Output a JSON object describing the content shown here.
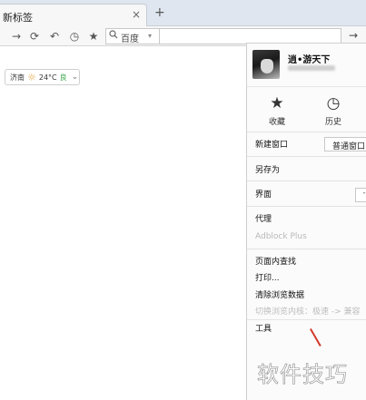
{
  "tab": {
    "title": "新标签",
    "close_glyph": "×",
    "new_tab_glyph": "+"
  },
  "toolbar": {
    "forward_glyph": "→",
    "refresh_glyph": "⟳",
    "undo_glyph": "↶",
    "history_glyph": "◷",
    "bookmark_glyph": "★",
    "search_engine": "百度",
    "search_caret": "▾",
    "go_glyph": "→"
  },
  "weather": {
    "city": "济南",
    "temp": "24°C",
    "aqi": "良",
    "caret": "⌄"
  },
  "menu": {
    "user": {
      "name": "逍•游天下"
    },
    "quick": [
      {
        "icon": "star-icon",
        "glyph": "★",
        "label": "收藏"
      },
      {
        "icon": "clock-icon",
        "glyph": "◷",
        "label": "历史"
      }
    ],
    "items": {
      "new_window": "新建窗口",
      "new_window_option": "普通窗口",
      "save_as": "另存为",
      "interface": "界面",
      "interface_button": "-",
      "proxy": "代理",
      "adblock": "Adblock Plus",
      "find": "页面内查找",
      "print": "打印...",
      "clear": "清除浏览数据",
      "switch_engine": "切换浏览内核：极速 -> 兼容",
      "tools": "工具"
    }
  },
  "watermark": "软件技巧",
  "colors": {
    "accent_sun": "#e8a23a",
    "aqi_good": "#3aa84b",
    "annotation": "#d23a2a"
  }
}
